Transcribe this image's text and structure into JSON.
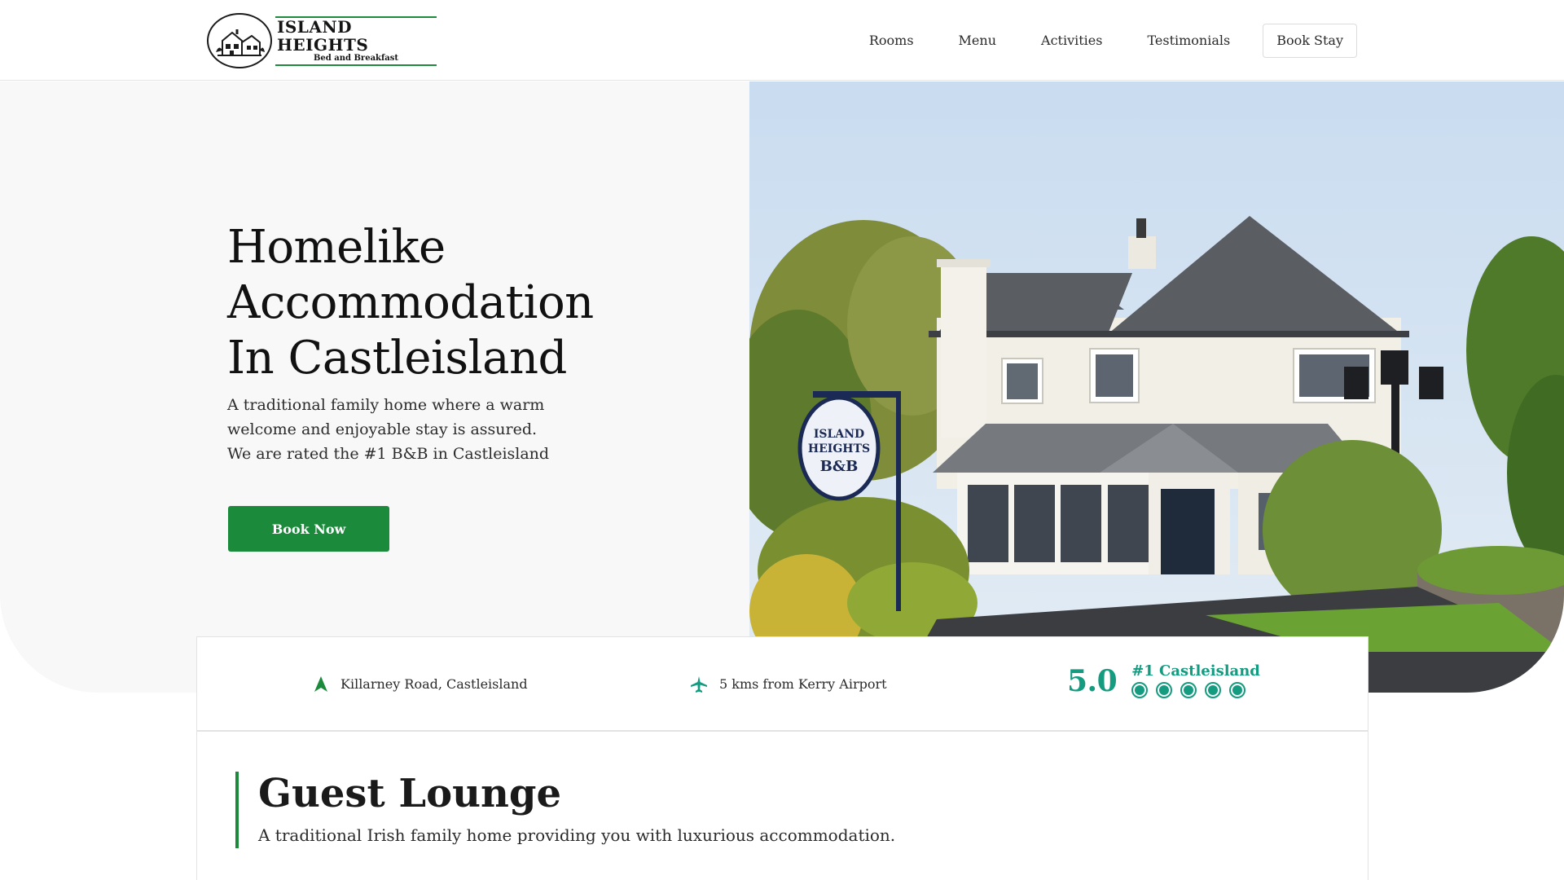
{
  "brand": {
    "name": "ISLAND HEIGHTS",
    "tagline": "Bed and Breakfast",
    "accent_color": "#1b8a3b",
    "rating_color": "#149b80"
  },
  "nav": {
    "items": [
      "Rooms",
      "Menu",
      "Activities",
      "Testimonials"
    ],
    "cta": "Book Stay"
  },
  "hero": {
    "title_lines": [
      "Homelike",
      "Accommodation",
      "In Castleisland"
    ],
    "subtitle_lines": [
      "A traditional family home where a warm",
      "welcome and enjoyable stay is assured.",
      "We are rated the #1 B&B in Castleisland"
    ],
    "button": "Book Now",
    "photo_sign": {
      "line1": "ISLAND",
      "line2": "HEIGHTS",
      "line3": "B&B"
    }
  },
  "info": {
    "location": "Killarney Road, Castleisland",
    "location_icon": "location-arrow-icon",
    "airport": "5 kms from Kerry Airport",
    "airport_icon": "airplane-icon",
    "rating_score": "5.0",
    "rating_label": "#1 Castleisland",
    "rating_dots": 5
  },
  "lounge": {
    "title": "Guest Lounge",
    "subtitle": "A traditional Irish family home providing you with luxurious accommodation."
  }
}
